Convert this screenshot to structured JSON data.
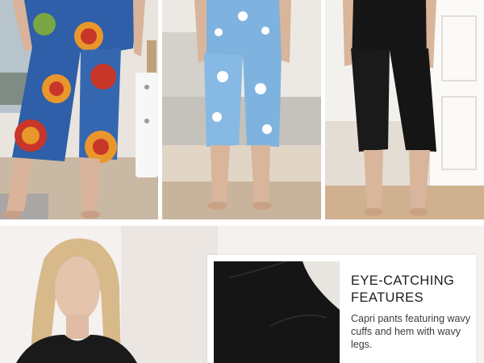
{
  "feature": {
    "title_line1": "EYE-CATCHING",
    "title_line2": "FEATURES",
    "description": "Capri pants featuring wavy cuffs and hem with wavy legs."
  },
  "photos": [
    {
      "name": "model-mandala-print-pajamas"
    },
    {
      "name": "model-blue-floral-pajamas"
    },
    {
      "name": "model-black-pajamas"
    },
    {
      "name": "model-portrait-black-top"
    },
    {
      "name": "sleeve-closeup"
    }
  ],
  "colors": {
    "mandala_blue": "#2e5fa8",
    "mandala_red": "#c8362a",
    "mandala_orange": "#e9962b",
    "floral_blue": "#7fb3df",
    "black_fabric": "#161616",
    "text_dark": "#1c1c1c"
  }
}
